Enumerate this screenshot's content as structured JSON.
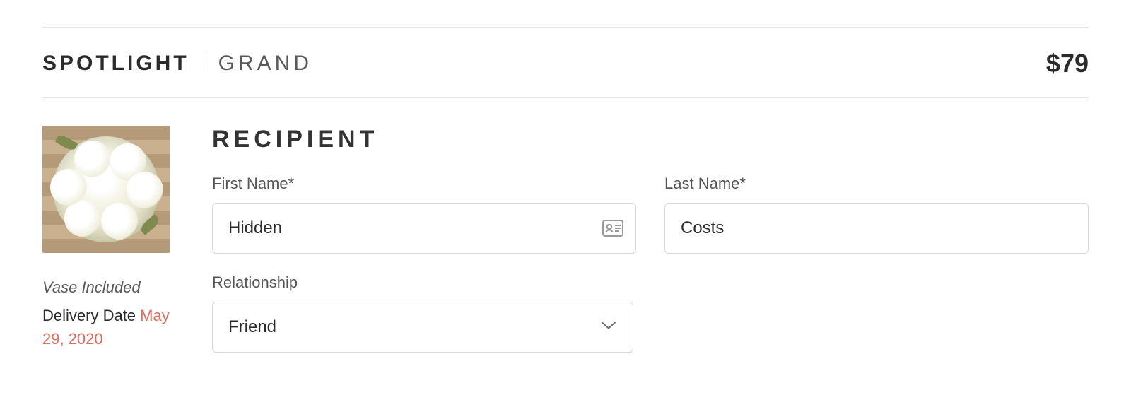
{
  "header": {
    "product_name": "SPOTLIGHT",
    "variant": "GRAND",
    "price": "$79"
  },
  "sidebar": {
    "vase_note": "Vase Included",
    "delivery_label": "Delivery Date",
    "delivery_date": "May 29, 2020"
  },
  "form": {
    "heading": "RECIPIENT",
    "first_name": {
      "label": "First Name*",
      "value": "Hidden"
    },
    "last_name": {
      "label": "Last Name*",
      "value": "Costs"
    },
    "relationship": {
      "label": "Relationship",
      "selected": "Friend"
    }
  }
}
